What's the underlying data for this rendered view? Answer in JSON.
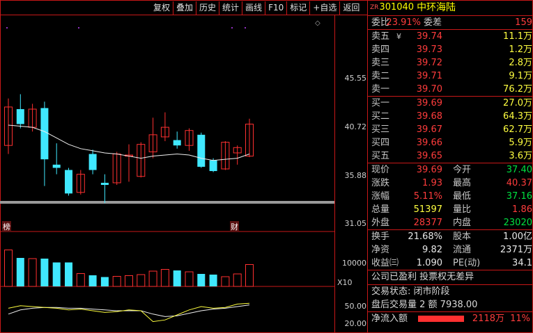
{
  "toolbar": [
    "复权",
    "叠加",
    "历史",
    "统计",
    "画线",
    "F10",
    "标记",
    "+自选",
    "返回"
  ],
  "axis": {
    "price_ticks": [
      "45.55",
      "40.72",
      "35.88",
      "31.05"
    ],
    "volume_ticks": [
      "10000",
      "X10"
    ],
    "indicator_ticks": [
      "50.00",
      "20.00"
    ]
  },
  "markers": {
    "left": "榜",
    "right": "财"
  },
  "chart_data": {
    "type": "candlestick",
    "ylim": [
      31.05,
      50.39
    ],
    "candles": [
      {
        "o": 38.2,
        "c": 41.8,
        "h": 42.6,
        "l": 37.4,
        "up": true
      },
      {
        "o": 41.6,
        "c": 40.2,
        "h": 43.0,
        "l": 39.8,
        "up": false
      },
      {
        "o": 39.9,
        "c": 41.6,
        "h": 42.1,
        "l": 39.5,
        "up": true
      },
      {
        "o": 41.7,
        "c": 36.9,
        "h": 42.3,
        "l": 34.4,
        "up": false
      },
      {
        "o": 36.4,
        "c": 36.1,
        "h": 38.4,
        "l": 35.5,
        "up": false
      },
      {
        "o": 35.9,
        "c": 33.7,
        "h": 36.1,
        "l": 33.5,
        "up": false
      },
      {
        "o": 33.8,
        "c": 35.5,
        "h": 35.9,
        "l": 33.6,
        "up": true
      },
      {
        "o": 35.9,
        "c": 37.4,
        "h": 37.8,
        "l": 35.5,
        "up": false
      },
      {
        "o": 34.7,
        "c": 34.5,
        "h": 35.5,
        "l": 32.8,
        "up": false
      },
      {
        "o": 34.7,
        "c": 37.4,
        "h": 37.6,
        "l": 34.5,
        "up": true
      },
      {
        "o": 37.2,
        "c": 37.3,
        "h": 38.3,
        "l": 34.8,
        "up": true
      },
      {
        "o": 35.3,
        "c": 38.3,
        "h": 38.5,
        "l": 35.2,
        "up": true
      },
      {
        "o": 37.6,
        "c": 39.2,
        "h": 40.8,
        "l": 37.0,
        "up": true
      },
      {
        "o": 39.0,
        "c": 39.9,
        "h": 41.3,
        "l": 38.6,
        "up": true
      },
      {
        "o": 38.7,
        "c": 38.2,
        "h": 39.5,
        "l": 37.9,
        "up": false
      },
      {
        "o": 38.2,
        "c": 39.6,
        "h": 39.8,
        "l": 37.7,
        "up": true
      },
      {
        "o": 39.2,
        "c": 36.2,
        "h": 39.4,
        "l": 36.1,
        "up": false
      },
      {
        "o": 36.8,
        "c": 35.8,
        "h": 37.0,
        "l": 35.7,
        "up": false
      },
      {
        "o": 36.0,
        "c": 38.5,
        "h": 38.6,
        "l": 35.9,
        "up": true
      },
      {
        "o": 37.5,
        "c": 38.0,
        "h": 38.2,
        "l": 36.4,
        "up": true
      },
      {
        "o": 37.2,
        "c": 40.2,
        "h": 40.7,
        "l": 37.1,
        "up": true
      }
    ],
    "ma": [
      40.1,
      40.0,
      39.9,
      39.5,
      38.9,
      38.3,
      37.9,
      37.7,
      37.5,
      37.4,
      37.2,
      37.0,
      37.2,
      37.3,
      37.4,
      37.3,
      37.0,
      36.8,
      36.9,
      37.0,
      37.4
    ],
    "volume": {
      "ylim": [
        0,
        14000
      ],
      "values": [
        10500,
        8200,
        8000,
        8000,
        6900,
        6900,
        3700,
        3200,
        2700,
        2900,
        3100,
        3400,
        4400,
        4900,
        4600,
        4200,
        3600,
        3400,
        2800,
        3600,
        6300
      ]
    },
    "indicator": {
      "ylim": [
        12,
        62
      ],
      "line1": [
        40,
        43,
        42,
        41,
        40,
        38,
        39,
        37,
        35,
        36,
        38,
        37,
        24,
        26,
        32,
        38,
        42,
        40,
        41,
        45,
        46
      ],
      "line2": [
        33,
        38,
        40,
        41,
        41,
        40,
        40,
        39,
        38,
        37,
        37,
        37,
        33,
        30,
        31,
        34,
        37,
        39,
        40,
        42,
        44
      ]
    }
  },
  "quote": {
    "zr": "ZR",
    "code": "301040",
    "name": "中环海陆",
    "ratio": {
      "l1": "委比",
      "v1": "23.91%",
      "l2": "委差",
      "v2": "159"
    },
    "asks": [
      {
        "label": "卖五",
        "mark": "¥",
        "price": "39.74",
        "vol": "11.1万"
      },
      {
        "label": "卖四",
        "mark": "",
        "price": "39.73",
        "vol": "1.2万"
      },
      {
        "label": "卖三",
        "mark": "",
        "price": "39.72",
        "vol": "2.8万"
      },
      {
        "label": "卖二",
        "mark": "",
        "price": "39.71",
        "vol": "9.1万"
      },
      {
        "label": "卖一",
        "mark": "",
        "price": "39.70",
        "vol": "76.2万"
      }
    ],
    "bids": [
      {
        "label": "买一",
        "price": "39.69",
        "vol": "27.0万"
      },
      {
        "label": "买二",
        "price": "39.68",
        "vol": "64.3万"
      },
      {
        "label": "买三",
        "price": "39.67",
        "vol": "62.7万"
      },
      {
        "label": "买四",
        "price": "39.66",
        "vol": "5.9万"
      },
      {
        "label": "买五",
        "price": "39.65",
        "vol": "3.6万"
      }
    ],
    "stats": [
      {
        "l1": "现价",
        "v1": "39.69",
        "c1": "red",
        "l2": "今开",
        "v2": "37.40",
        "c2": "green"
      },
      {
        "l1": "涨跌",
        "v1": "1.93",
        "c1": "red",
        "l2": "最高",
        "v2": "40.37",
        "c2": "red"
      },
      {
        "l1": "涨幅",
        "v1": "5.11%",
        "c1": "red",
        "l2": "最低",
        "v2": "37.16",
        "c2": "green"
      },
      {
        "l1": "总量",
        "v1": "51397",
        "c1": "yellow",
        "l2": "量比",
        "v2": "1.86",
        "c2": "red"
      },
      {
        "l1": "外盘",
        "v1": "28377",
        "c1": "red",
        "l2": "内盘",
        "v2": "23020",
        "c2": "green"
      }
    ],
    "stats2": [
      {
        "l1": "换手",
        "v1": "21.68%",
        "l2": "股本",
        "v2": "1.00亿"
      },
      {
        "l1": "净资",
        "v1": "9.82",
        "l2": "流通",
        "v2": "2371万"
      },
      {
        "l1": "收益㈢",
        "v1": "1.090",
        "l2": "PE(动)",
        "v2": "34.1"
      }
    ],
    "info": [
      "公司已盈利 投票权无差异"
    ],
    "trade": [
      "交易状态: 闭市阶段",
      "盘后交易量 2 额 7938.00"
    ],
    "flow": {
      "label": "净流入额",
      "amount": "2118万",
      "pct": "11%",
      "ratio": 0.11
    }
  }
}
